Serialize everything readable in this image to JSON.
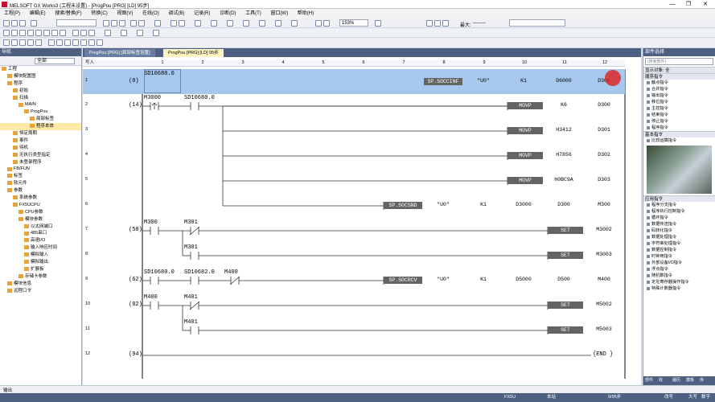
{
  "window": {
    "title": "MELSOFT GX Works3 (工程未设置) - [ProgPou [PRG] [LD] 95步]",
    "min": "—",
    "max": "❐",
    "close": "✕"
  },
  "menu": [
    "工程(P)",
    "编辑(E)",
    "搜索/替换(F)",
    "转换(C)",
    "视图(V)",
    "在线(O)",
    "调试(B)",
    "记录(R)",
    "诊断(D)",
    "工具(T)",
    "窗口(W)",
    "帮助(H)"
  ],
  "toolbar": {
    "zoom": "153%",
    "max_label": "最大:",
    "max_value": "--------"
  },
  "navigation": {
    "title": "导航",
    "filter_label": "全部",
    "tree": [
      {
        "label": "工程",
        "indent": 0
      },
      {
        "label": "模块配置图",
        "indent": 1
      },
      {
        "label": "程序",
        "indent": 1
      },
      {
        "label": "初始",
        "indent": 2
      },
      {
        "label": "扫描",
        "indent": 2
      },
      {
        "label": "MAIN",
        "indent": 3
      },
      {
        "label": "ProgPou",
        "indent": 4
      },
      {
        "label": "局部标签",
        "indent": 5
      },
      {
        "label": "程序本体",
        "indent": 5,
        "selected": true
      },
      {
        "label": "恒定周期",
        "indent": 2
      },
      {
        "label": "事件",
        "indent": 2
      },
      {
        "label": "待机",
        "indent": 2
      },
      {
        "label": "无执行类型指定",
        "indent": 2
      },
      {
        "label": "未登录程序",
        "indent": 2
      },
      {
        "label": "FB/FUN",
        "indent": 1
      },
      {
        "label": "标签",
        "indent": 1
      },
      {
        "label": "软元件",
        "indent": 1
      },
      {
        "label": "参数",
        "indent": 1
      },
      {
        "label": "系统参数",
        "indent": 2
      },
      {
        "label": "FX5UCPU",
        "indent": 2
      },
      {
        "label": "CPU参数",
        "indent": 3
      },
      {
        "label": "模块参数",
        "indent": 3
      },
      {
        "label": "以太网端口",
        "indent": 4
      },
      {
        "label": "485串口",
        "indent": 4
      },
      {
        "label": "高速I/O",
        "indent": 4
      },
      {
        "label": "输入响应时间",
        "indent": 4
      },
      {
        "label": "模拟输入",
        "indent": 4
      },
      {
        "label": "模拟输出",
        "indent": 4
      },
      {
        "label": "扩展板",
        "indent": 4
      },
      {
        "label": "存储卡参数",
        "indent": 3
      },
      {
        "label": "模块信息",
        "indent": 1
      },
      {
        "label": "远程口令",
        "indent": 1
      }
    ]
  },
  "tabs": [
    {
      "label": "ProgPou [PRG] [局部标签设置]",
      "active": false
    },
    {
      "label": "ProgPou [PRG] [LD] 95步",
      "active": true
    }
  ],
  "ladder": {
    "corner": "写入",
    "columns": [
      "1",
      "2",
      "3",
      "4",
      "5",
      "6",
      "7",
      "8",
      "9",
      "10",
      "11",
      "12"
    ],
    "rows": [
      {
        "num": "1",
        "step": "(0)"
      },
      {
        "num": "2",
        "step": "(14)"
      },
      {
        "num": "3",
        "step": ""
      },
      {
        "num": "4",
        "step": ""
      },
      {
        "num": "5",
        "step": ""
      },
      {
        "num": "6",
        "step": ""
      },
      {
        "num": "7",
        "step": "(50)"
      },
      {
        "num": "8",
        "step": ""
      },
      {
        "num": "9",
        "step": "(62)"
      },
      {
        "num": "10",
        "step": "(82)"
      },
      {
        "num": "11",
        "step": ""
      },
      {
        "num": "12",
        "step": "(94)"
      }
    ],
    "r1": {
      "contact": "SD10680.0",
      "inst": "SP.SOCCINF",
      "a1": "\"U0\"",
      "a2": "K1",
      "a3": "D6000",
      "a4": "D300"
    },
    "r2": {
      "c1": "M3000",
      "c2": "SD10680.0",
      "inst": "MOVP",
      "a1": "K6",
      "a2": "D300"
    },
    "r3": {
      "inst": "MOVP",
      "a1": "H3412",
      "a2": "D301"
    },
    "r4": {
      "inst": "MOVP",
      "a1": "H7856",
      "a2": "D302"
    },
    "r5": {
      "inst": "MOVP",
      "a1": "H0BC9A",
      "a2": "D303"
    },
    "r6": {
      "inst": "SP.SOCSND",
      "a1": "\"U0\"",
      "a2": "K1",
      "a3": "D3000",
      "a4": "D300",
      "a5": "M300"
    },
    "r7": {
      "c1": "M300",
      "c2": "M301",
      "inst": "SET",
      "a1": "M3002"
    },
    "r8": {
      "c1": "M301",
      "inst": "SET",
      "a1": "M3003"
    },
    "r9": {
      "c1": "SD10680.0",
      "c2": "SD10682.0",
      "c3": "M400",
      "inst": "SP.SOCRCV",
      "a1": "\"U0\"",
      "a2": "K1",
      "a3": "D5000",
      "a4": "D500",
      "a5": "M400"
    },
    "r10": {
      "c1": "M400",
      "c2": "M401",
      "inst": "SET",
      "a1": "M5002"
    },
    "r11": {
      "c1": "M401",
      "inst": "SET",
      "a1": "M5003"
    },
    "r12": {
      "end": "{END }"
    }
  },
  "parts": {
    "title": "部件选择",
    "search": "(搜索部件)",
    "section1": "显示对象:",
    "section1_value": "全",
    "basic_title": "顺序指令",
    "basic_items": [
      "触点指令",
      "合并指令",
      "输出指令",
      "移位指令",
      "主控指令",
      "结束指令",
      "停止指令",
      "程序指令"
    ],
    "basic2_title": "基本指令",
    "basic2_items": [
      "比较运算指令"
    ],
    "app_title": "应用指令",
    "app_items": [
      "程序分支指令",
      "程序执行控制指令",
      "循环指令",
      "数据传送指令",
      "码转化指令",
      "数据处理指令",
      "字符串处理指令",
      "数据控制指令",
      "时钟用指令",
      "外部设备I/O指令",
      "浮点指令",
      "随机数指令",
      "定址寄存器操作指令",
      "特殊计数器指令"
    ],
    "tabs": [
      "部件",
      "收",
      "履历",
      "模板",
      "库"
    ]
  },
  "status": {
    "bottom_title": "输出",
    "plc": "FX5U",
    "mode": "本站",
    "steps": "0/95步",
    "ovr": "改写",
    "caps": "大写",
    "num": "数字"
  }
}
